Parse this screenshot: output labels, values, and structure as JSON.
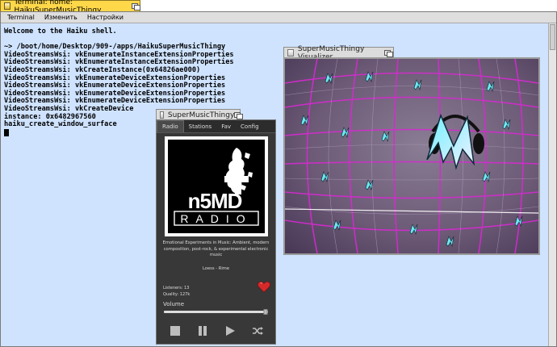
{
  "terminal": {
    "title": "Terminal: home: HaikuSuperMusicThingy",
    "menu": [
      "Terminal",
      "Изменить",
      "Настройки"
    ],
    "lines": [
      "Welcome to the Haiku shell.",
      "",
      "~> /boot/home/Desktop/909-/apps/HaikuSuperMusicThingy",
      "VideoStreamsWsi: vkEnumerateInstanceExtensionProperties",
      "VideoStreamsWsi: vkEnumerateInstanceExtensionProperties",
      "VideoStreamsWsi: vkCreateInstance(0x64826ae000)",
      "VideoStreamsWsi: vkEnumerateDeviceExtensionProperties",
      "VideoStreamsWsi: vkEnumerateDeviceExtensionProperties",
      "VideoStreamsWsi: vkEnumerateDeviceExtensionProperties",
      "VideoStreamsWsi: vkEnumerateDeviceExtensionProperties",
      "VideoStreamsWsi: vkCreateDevice",
      "instance: 0x6482967560",
      "haiku_create_window_surface"
    ]
  },
  "visualizer": {
    "title": "SuperMusicThingy Visualizer",
    "logo_letter": "M"
  },
  "player": {
    "title": "SuperMusicThingy",
    "tabs": [
      "Radio",
      "Stations",
      "Fav",
      "Config"
    ],
    "active_tab": "Radio",
    "cover": {
      "big": "n5MD",
      "small": "RADIO"
    },
    "description": "Emotional Experiments in Music: Ambient, modern composition, post-rock, & experimental electronic music",
    "track": "Loess - Rime",
    "listeners": "Listeners: 13",
    "quality": "Quality: 127k",
    "volume_label": "Volume",
    "volume_level": 0.98,
    "favorite_icon": "heart-icon",
    "controls": [
      "stop-icon",
      "pause-icon",
      "play-icon",
      "shuffle-icon"
    ],
    "colors": {
      "tab_active": "#ffd84a",
      "terminal_bg": "#cfe3ff",
      "heart": "#d62a2a",
      "viz_grid": "#d020c8"
    }
  }
}
